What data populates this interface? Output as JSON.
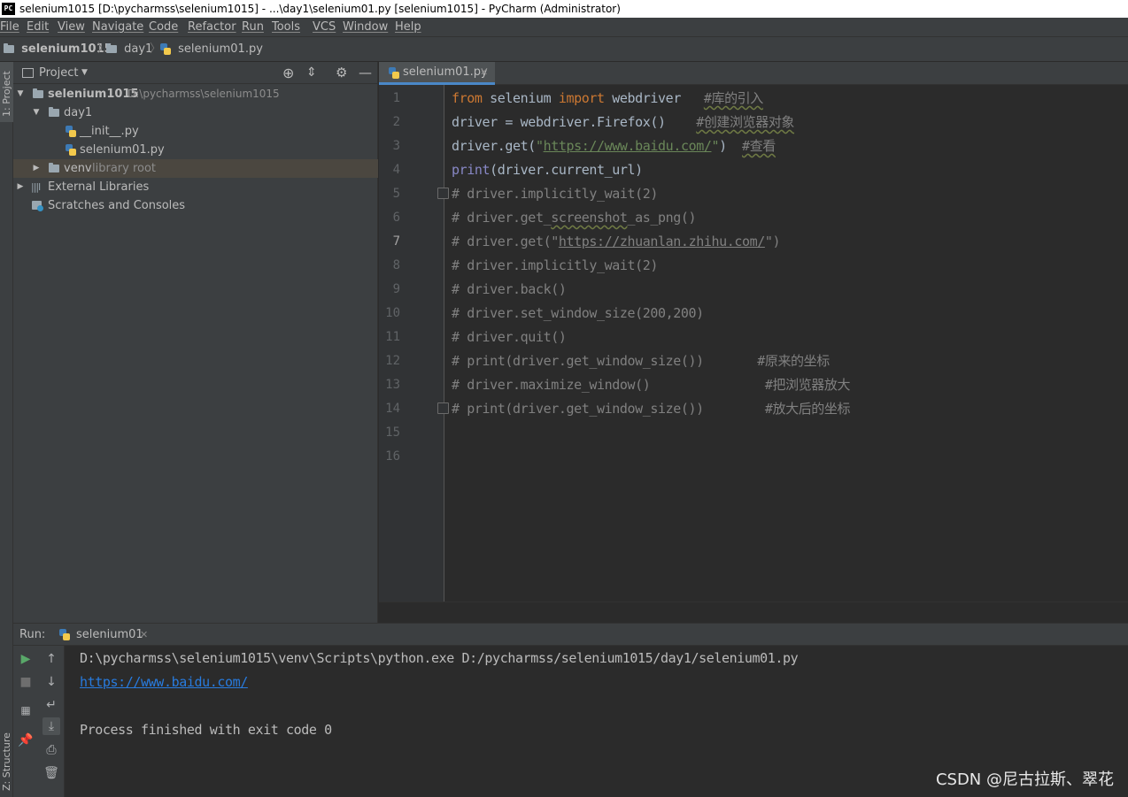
{
  "window": {
    "title": "selenium1015 [D:\\pycharmss\\selenium1015] - ...\\day1\\selenium01.py [selenium1015] - PyCharm (Administrator)",
    "app_icon_text": "PC"
  },
  "menu": [
    "File",
    "Edit",
    "View",
    "Navigate",
    "Code",
    "Refactor",
    "Run",
    "Tools",
    "VCS",
    "Window",
    "Help"
  ],
  "breadcrumb": {
    "project": "selenium1015",
    "folder": "day1",
    "file": "selenium01.py"
  },
  "left_stripe": {
    "project_tab": "1: Project",
    "structure_tab": "Z: Structure"
  },
  "project_panel": {
    "title": "Project",
    "tree": {
      "root_name": "selenium1015",
      "root_path": "D:\\pycharmss\\selenium1015",
      "day1": "day1",
      "init_file": "__init__.py",
      "main_file": "selenium01.py",
      "venv": "venv",
      "venv_note": "library root",
      "external": "External Libraries",
      "scratches": "Scratches and Consoles"
    }
  },
  "editor": {
    "tab_label": "selenium01.py",
    "current_line": 7,
    "lines": [
      [
        {
          "t": "from",
          "c": "kw"
        },
        {
          "t": " selenium ",
          "c": ""
        },
        {
          "t": "import",
          "c": "kw"
        },
        {
          "t": " webdriver   ",
          "c": ""
        },
        {
          "t": "#库的引入",
          "c": "cmt squig"
        }
      ],
      [
        {
          "t": "driver = webdriver.Firefox()    ",
          "c": ""
        },
        {
          "t": "#创建浏览器对象",
          "c": "cmt squig"
        }
      ],
      [
        {
          "t": "driver.get(",
          "c": ""
        },
        {
          "t": "\"",
          "c": "str"
        },
        {
          "t": "https://www.baidu.com/",
          "c": "url"
        },
        {
          "t": "\"",
          "c": "str"
        },
        {
          "t": ")  ",
          "c": ""
        },
        {
          "t": "#查看",
          "c": "cmt squig"
        }
      ],
      [
        {
          "t": "print",
          "c": "fn"
        },
        {
          "t": "(driver.current_url)",
          "c": ""
        }
      ],
      [
        {
          "t": "# driver.implicitly_wait(2)",
          "c": "cmt"
        }
      ],
      [
        {
          "t": "# driver.get_",
          "c": "cmt"
        },
        {
          "t": "screenshot",
          "c": "cmt squig"
        },
        {
          "t": "_as_png()",
          "c": "cmt"
        }
      ],
      [
        {
          "t": "# driver.get(\"",
          "c": "cmt"
        },
        {
          "t": "https://zhuanlan.zhihu.com/",
          "c": "curl"
        },
        {
          "t": "\")",
          "c": "cmt"
        }
      ],
      [
        {
          "t": "# driver.implicitly_wait(2)",
          "c": "cmt"
        }
      ],
      [
        {
          "t": "# driver.back()",
          "c": "cmt"
        }
      ],
      [
        {
          "t": "# driver.set_window_size(200,200)",
          "c": "cmt"
        }
      ],
      [
        {
          "t": "# driver.quit()",
          "c": "cmt"
        }
      ],
      [
        {
          "t": "# print(driver.get_window_size())       #原来的坐标",
          "c": "cmt"
        }
      ],
      [
        {
          "t": "# driver.maximize_window()               #把浏览器放大",
          "c": "cmt"
        }
      ],
      [
        {
          "t": "# print(driver.get_window_size())        #放大后的坐标",
          "c": "cmt"
        }
      ],
      [],
      []
    ]
  },
  "run_panel": {
    "label": "Run:",
    "tab_label": "selenium01",
    "console": {
      "command": "D:\\pycharmss\\selenium1015\\venv\\Scripts\\python.exe D:/pycharmss/selenium1015/day1/selenium01.py",
      "output_url": "https://www.baidu.com/",
      "exit_message": "Process finished with exit code 0"
    }
  },
  "watermark": "CSDN @尼古拉斯、翠花"
}
